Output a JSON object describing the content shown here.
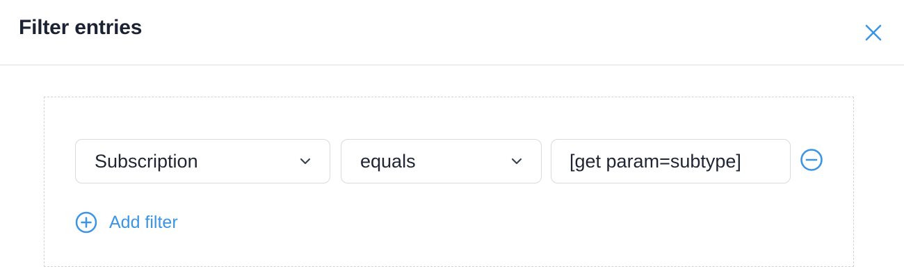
{
  "dialog": {
    "title": "Filter entries",
    "accent_color": "#3b94e4"
  },
  "filters": [
    {
      "field": "Subscription",
      "operator": "equals",
      "value": "[get param=subtype]"
    }
  ],
  "actions": {
    "add_filter_label": "Add filter"
  },
  "icons": {
    "close": "close-icon",
    "chevron": "chevron-down-icon",
    "remove": "minus-circle-icon",
    "add": "plus-circle-icon"
  }
}
